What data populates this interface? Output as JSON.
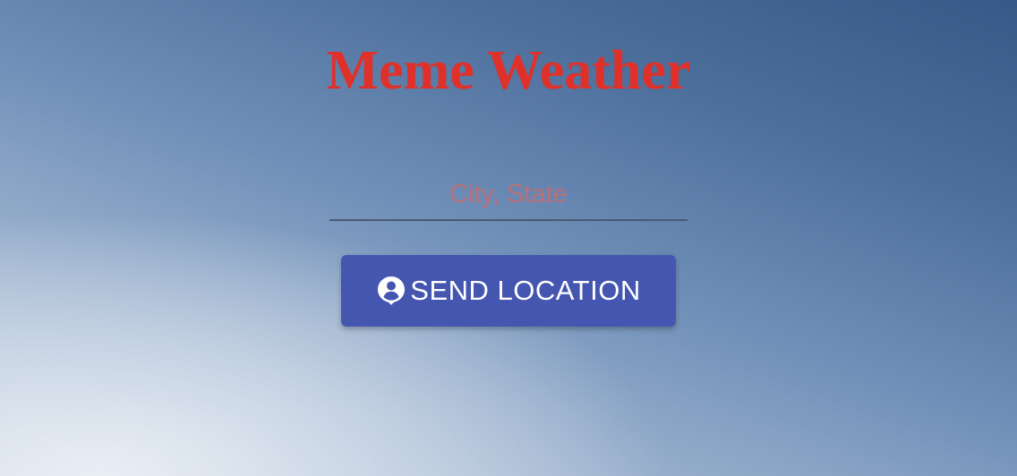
{
  "app": {
    "title": "Meme Weather",
    "title_color": "#e0302a"
  },
  "location_form": {
    "input_value": "",
    "input_placeholder": "City, State",
    "submit_label": "SEND LOCATION",
    "submit_icon": "person-pin-icon",
    "button_color": "#4456b0"
  }
}
